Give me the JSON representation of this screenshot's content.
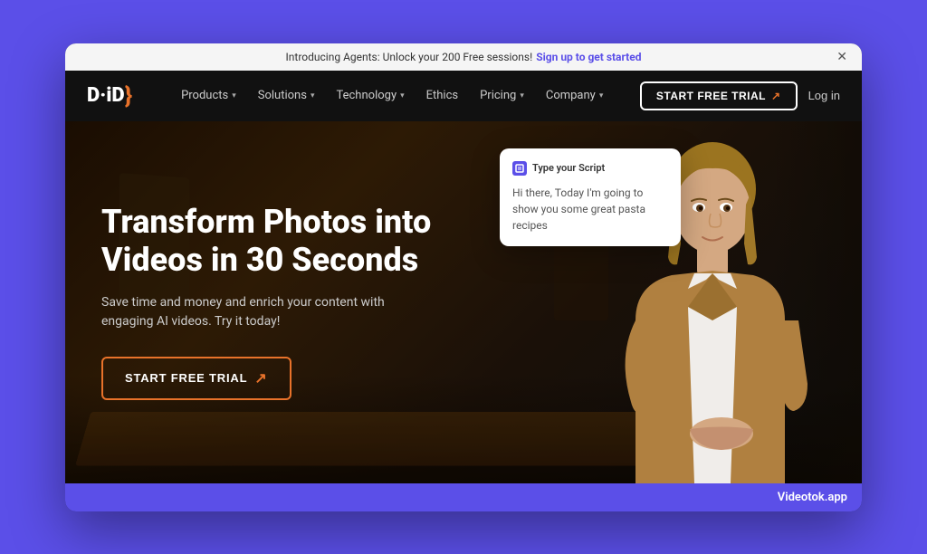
{
  "announcement": {
    "text": "Introducing Agents: Unlock your 200 Free sessions!",
    "cta": "Sign up to get started"
  },
  "navbar": {
    "logo": "D·iD",
    "nav_items": [
      {
        "label": "Products",
        "has_dropdown": true
      },
      {
        "label": "Solutions",
        "has_dropdown": true
      },
      {
        "label": "Technology",
        "has_dropdown": true
      },
      {
        "label": "Ethics",
        "has_dropdown": false
      },
      {
        "label": "Pricing",
        "has_dropdown": true
      },
      {
        "label": "Company",
        "has_dropdown": true
      }
    ],
    "trial_button": "START FREE TRIAL",
    "login_button": "Log in"
  },
  "hero": {
    "title": "Transform Photos into Videos in 30 Seconds",
    "subtitle": "Save time and money and enrich your content with engaging AI videos. Try it today!",
    "cta_button": "START FREE TRIAL"
  },
  "script_card": {
    "title": "Type your Script",
    "body": "Hi there, Today I'm going to show you some great pasta recipes"
  },
  "watermark": {
    "text": "Videotok.app"
  }
}
